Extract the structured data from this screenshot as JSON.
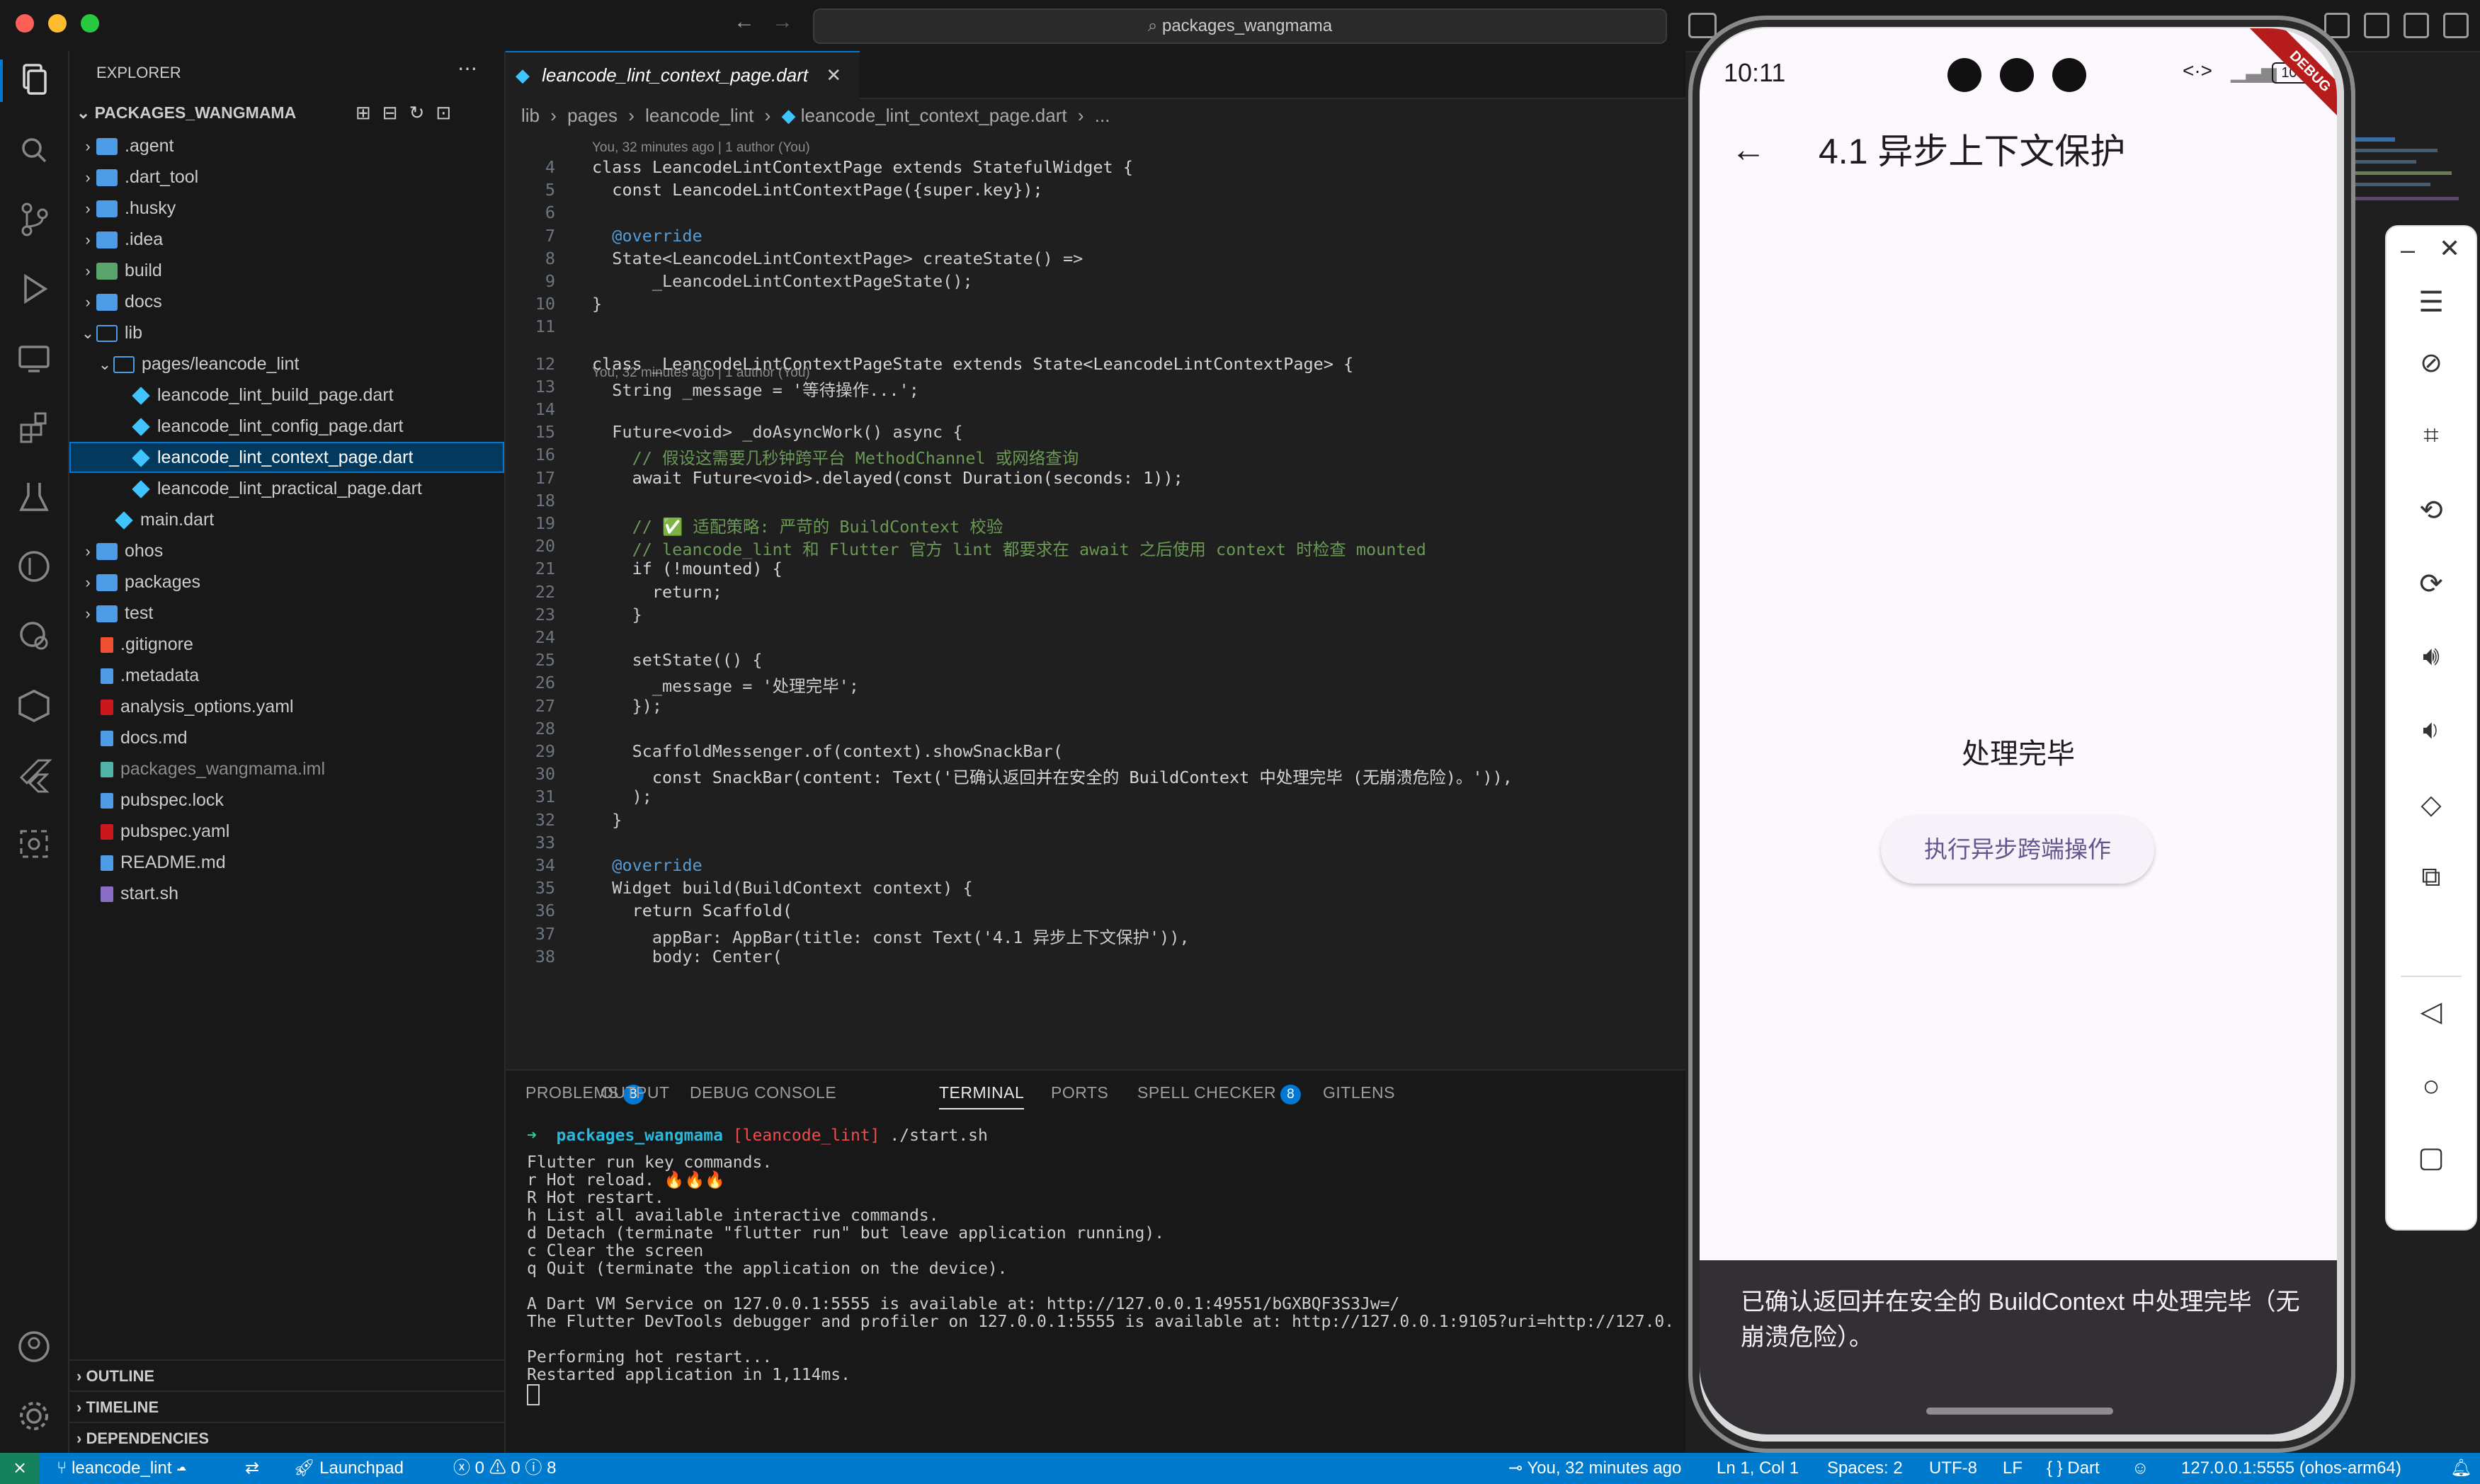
{
  "window": {
    "search_text": "packages_wangmama"
  },
  "sidebar": {
    "title": "EXPLORER",
    "root": "PACKAGES_WANGMAMA",
    "items": [
      {
        "label": ".agent",
        "kind": "folder",
        "depth": 0,
        "chevron": "›"
      },
      {
        "label": ".dart_tool",
        "kind": "folder",
        "depth": 0,
        "chevron": "›"
      },
      {
        "label": ".husky",
        "kind": "folder",
        "depth": 0,
        "chevron": "›"
      },
      {
        "label": ".idea",
        "kind": "folder",
        "depth": 0,
        "chevron": "›"
      },
      {
        "label": "build",
        "kind": "folder-build",
        "depth": 0,
        "chevron": "›"
      },
      {
        "label": "docs",
        "kind": "folder",
        "depth": 0,
        "chevron": "›"
      },
      {
        "label": "lib",
        "kind": "folder-open",
        "depth": 0,
        "chevron": "⌄"
      },
      {
        "label": "pages/leancode_lint",
        "kind": "folder-open",
        "depth": 1,
        "chevron": "⌄"
      },
      {
        "label": "leancode_lint_build_page.dart",
        "kind": "dart",
        "depth": 2,
        "chevron": ""
      },
      {
        "label": "leancode_lint_config_page.dart",
        "kind": "dart",
        "depth": 2,
        "chevron": ""
      },
      {
        "label": "leancode_lint_context_page.dart",
        "kind": "dart",
        "depth": 2,
        "chevron": "",
        "selected": true
      },
      {
        "label": "leancode_lint_practical_page.dart",
        "kind": "dart",
        "depth": 2,
        "chevron": ""
      },
      {
        "label": "main.dart",
        "kind": "dart",
        "depth": 1,
        "chevron": ""
      },
      {
        "label": "ohos",
        "kind": "folder",
        "depth": 0,
        "chevron": "›"
      },
      {
        "label": "packages",
        "kind": "folder",
        "depth": 0,
        "chevron": "›"
      },
      {
        "label": "test",
        "kind": "folder",
        "depth": 0,
        "chevron": "›"
      },
      {
        "label": ".gitignore",
        "kind": "git",
        "depth": 0,
        "chevron": ""
      },
      {
        "label": ".metadata",
        "kind": "file",
        "depth": 0,
        "chevron": ""
      },
      {
        "label": "analysis_options.yaml",
        "kind": "yaml",
        "depth": 0,
        "chevron": ""
      },
      {
        "label": "docs.md",
        "kind": "md",
        "depth": 0,
        "chevron": ""
      },
      {
        "label": "packages_wangmama.iml",
        "kind": "xml",
        "depth": 0,
        "chevron": ""
      },
      {
        "label": "pubspec.lock",
        "kind": "file",
        "depth": 0,
        "chevron": ""
      },
      {
        "label": "pubspec.yaml",
        "kind": "yaml",
        "depth": 0,
        "chevron": ""
      },
      {
        "label": "README.md",
        "kind": "md",
        "depth": 0,
        "chevron": ""
      },
      {
        "label": "start.sh",
        "kind": "sh",
        "depth": 0,
        "chevron": ""
      }
    ],
    "sections": [
      "OUTLINE",
      "TIMELINE",
      "DEPENDENCIES"
    ]
  },
  "editor": {
    "tab_label": "leancode_lint_context_page.dart",
    "breadcrumb": [
      "lib",
      "pages",
      "leancode_lint",
      "leancode_lint_context_page.dart",
      "..."
    ],
    "blame1": "You, 32 minutes ago | 1 author (You)",
    "blame2": "You, 32 minutes ago | 1 author (You)",
    "lines": [
      {
        "n": "4",
        "code": "class LeancodeLintContextPage extends StatefulWidget {"
      },
      {
        "n": "5",
        "code": "  const LeancodeLintContextPage({super.key});"
      },
      {
        "n": "6",
        "code": ""
      },
      {
        "n": "7",
        "code": "  @override"
      },
      {
        "n": "8",
        "code": "  State<LeancodeLintContextPage> createState() =>"
      },
      {
        "n": "9",
        "code": "      _LeancodeLintContextPageState();"
      },
      {
        "n": "10",
        "code": "}"
      },
      {
        "n": "11",
        "code": ""
      },
      {
        "n": "12",
        "code": "class _LeancodeLintContextPageState extends State<LeancodeLintContextPage> {"
      },
      {
        "n": "13",
        "code": "  String _message = '等待操作...';"
      },
      {
        "n": "14",
        "code": ""
      },
      {
        "n": "15",
        "code": "  Future<void> _doAsyncWork() async {"
      },
      {
        "n": "16",
        "code": "    // 假设这需要几秒钟跨平台 MethodChannel 或网络查询"
      },
      {
        "n": "17",
        "code": "    await Future<void>.delayed(const Duration(seconds: 1));"
      },
      {
        "n": "18",
        "code": ""
      },
      {
        "n": "19",
        "code": "    // ✅ 适配策略: 严苛的 BuildContext 校验"
      },
      {
        "n": "20",
        "code": "    // leancode_lint 和 Flutter 官方 lint 都要求在 await 之后使用 context 时检查 mounted"
      },
      {
        "n": "21",
        "code": "    if (!mounted) {"
      },
      {
        "n": "22",
        "code": "      return;"
      },
      {
        "n": "23",
        "code": "    }"
      },
      {
        "n": "24",
        "code": ""
      },
      {
        "n": "25",
        "code": "    setState(() {"
      },
      {
        "n": "26",
        "code": "      _message = '处理完毕';"
      },
      {
        "n": "27",
        "code": "    });"
      },
      {
        "n": "28",
        "code": ""
      },
      {
        "n": "29",
        "code": "    ScaffoldMessenger.of(context).showSnackBar("
      },
      {
        "n": "30",
        "code": "      const SnackBar(content: Text('已确认返回并在安全的 BuildContext 中处理完毕 (无崩溃危险)。')),"
      },
      {
        "n": "31",
        "code": "    );"
      },
      {
        "n": "32",
        "code": "  }"
      },
      {
        "n": "33",
        "code": ""
      },
      {
        "n": "34",
        "code": "  @override"
      },
      {
        "n": "35",
        "code": "  Widget build(BuildContext context) {"
      },
      {
        "n": "36",
        "code": "    return Scaffold("
      },
      {
        "n": "37",
        "code": "      appBar: AppBar(title: const Text('4.1 异步上下文保护')),"
      },
      {
        "n": "38",
        "code": "      body: Center("
      }
    ]
  },
  "panel": {
    "tabs": [
      {
        "label": "PROBLEMS",
        "badge": "8"
      },
      {
        "label": "OUTPUT",
        "badge": ""
      },
      {
        "label": "DEBUG CONSOLE",
        "badge": ""
      },
      {
        "label": "TERMINAL",
        "badge": ""
      },
      {
        "label": "PORTS",
        "badge": ""
      },
      {
        "label": "SPELL CHECKER",
        "badge": "8"
      },
      {
        "label": "GITLENS",
        "badge": ""
      }
    ],
    "active_tab": "TERMINAL",
    "prompt_dir": "packages_wangmama",
    "prompt_branch": "[leancode_lint]",
    "prompt_cmd": "./start.sh",
    "terminal_lines": [
      "Flutter run key commands.",
      "r Hot reload. 🔥🔥🔥",
      "R Hot restart.",
      "h List all available interactive commands.",
      "d Detach (terminate \"flutter run\" but leave application running).",
      "c Clear the screen",
      "q Quit (terminate the application on the device).",
      "",
      "A Dart VM Service on 127.0.0.1:5555 is available at: http://127.0.0.1:49551/bGXBQF3S3Jw=/",
      "The Flutter DevTools debugger and profiler on 127.0.0.1:5555 is available at: http://127.0.0.1:9105?uri=http://127.0.",
      "",
      "Performing hot restart...",
      "Restarted application in 1,114ms."
    ]
  },
  "statusbar": {
    "branch": "leancode_lint",
    "launchpad": "Launchpad",
    "errors": "0",
    "warnings": "0",
    "infos": "8",
    "blame": "You, 32 minutes ago",
    "position": "Ln 1, Col 1",
    "spaces": "Spaces: 2",
    "encoding": "UTF-8",
    "eol": "LF",
    "language": "Dart",
    "device": "127.0.0.1:5555 (ohos-arm64)"
  },
  "phone": {
    "time": "10:11",
    "battery": "100",
    "debug_banner": "DEBUG",
    "appbar_title": "4.1 异步上下文保护",
    "message": "处理完毕",
    "button_label": "执行异步跨端操作",
    "snackbar_text": "已确认返回并在安全的 BuildContext 中处理完毕（无崩溃危险）。"
  },
  "colors": {
    "accent": "#0078d4",
    "statusbar": "#007acc",
    "app_bg": "#fdf7fe",
    "button_text": "#65558f",
    "snackbar_bg": "#322f35"
  }
}
